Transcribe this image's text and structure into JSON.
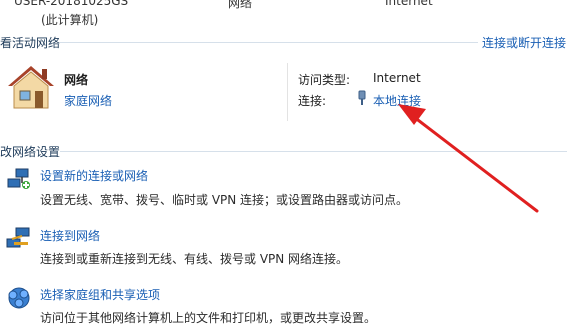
{
  "top_row": {
    "computer_name_line1": "USER-20181025GS",
    "computer_name_line2": "(此计算机)",
    "network": "网络",
    "internet": "Internet"
  },
  "active_networks": {
    "heading": "看活动网络",
    "connect_disconnect_link": "连接或断开连接",
    "network_name": "网络",
    "network_type_link": "家庭网络",
    "access_type_label": "访问类型:",
    "access_type_value": "Internet",
    "connections_label": "连接:",
    "connection_link": "本地连接"
  },
  "change_settings": {
    "heading": "改网络设置",
    "tasks": [
      {
        "title": "设置新的连接或网络",
        "desc": "设置无线、宽带、拨号、临时或 VPN 连接；或设置路由器或访问点。",
        "icon": "network-setup-icon"
      },
      {
        "title": "连接到网络",
        "desc": "连接到或重新连接到无线、有线、拨号或 VPN 网络连接。",
        "icon": "connect-network-icon"
      },
      {
        "title": "选择家庭组和共享选项",
        "desc": "访问位于其他网络计算机上的文件和打印机，或更改共享设置。",
        "icon": "homegroup-icon"
      }
    ]
  },
  "colors": {
    "link": "#1a5fb4",
    "arrow": "#e02020"
  }
}
